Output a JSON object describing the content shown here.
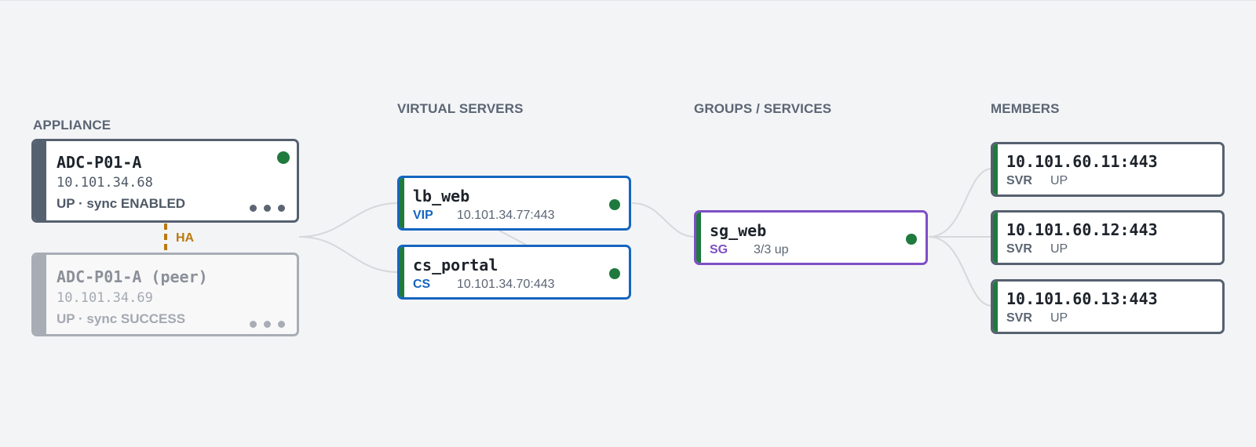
{
  "columns": {
    "appliance": "APPLIANCE",
    "virtual_servers": "VIRTUAL SERVERS",
    "groups": "GROUPS / SERVICES",
    "members": "MEMBERS"
  },
  "appliance": {
    "name": "ADC-P01-A",
    "ip": "10.101.34.68",
    "status": "UP · sync ENABLED",
    "state": "up"
  },
  "peer": {
    "name": "ADC-P01-A (peer)",
    "ip": "10.101.34.69",
    "status": "UP · sync SUCCESS"
  },
  "ha": {
    "label": "HA"
  },
  "virtual_servers": [
    {
      "name": "lb_web",
      "kind": "VIP",
      "address": "10.101.34.77:443",
      "state": "up"
    },
    {
      "name": "cs_portal",
      "kind": "CS",
      "address": "10.101.34.70:443",
      "state": "up"
    }
  ],
  "groups": [
    {
      "name": "sg_web",
      "kind": "SG",
      "summary": "3/3 up",
      "state": "up"
    }
  ],
  "members": [
    {
      "name": "10.101.60.11:443",
      "kind": "SVR",
      "status": "UP"
    },
    {
      "name": "10.101.60.12:443",
      "kind": "SVR",
      "status": "UP"
    },
    {
      "name": "10.101.60.13:443",
      "kind": "SVR",
      "status": "UP"
    }
  ],
  "colors": {
    "up": "#1f7a3d",
    "vserver_border": "#1565c0",
    "group_border": "#7e4fc4",
    "member_border": "#566170",
    "ha": "#b97a12",
    "link": "#d6d8dc"
  }
}
